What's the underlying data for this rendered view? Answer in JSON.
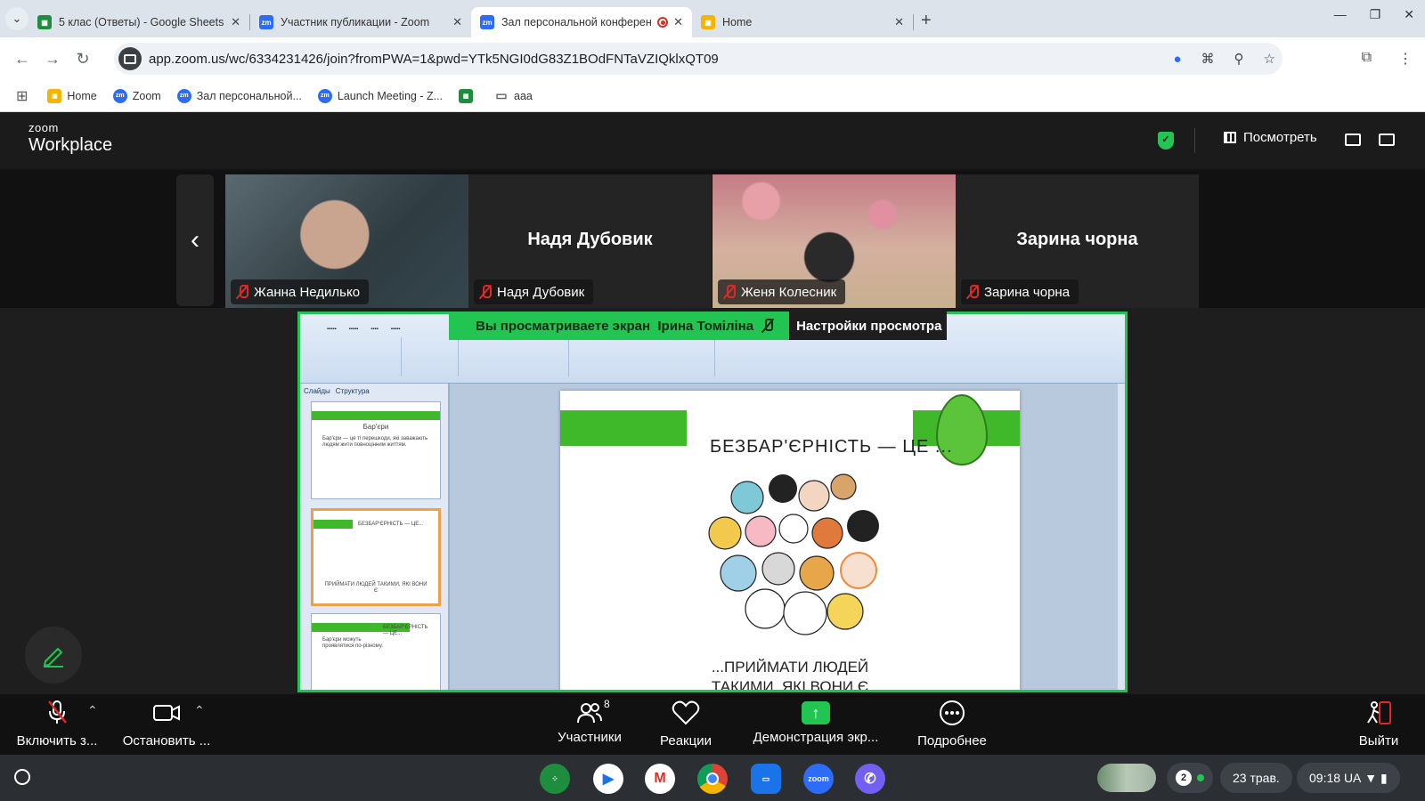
{
  "browser": {
    "tabs": [
      {
        "title": "5 клас (Ответы) - Google Sheets",
        "favicon": "sheets-icon",
        "color": "#1e8e3e",
        "active": false
      },
      {
        "title": "Участник публикации - Zoom",
        "favicon": "zoom-icon",
        "color": "#2d6cf6",
        "active": false
      },
      {
        "title": "Зал персональной конференции",
        "favicon": "zoom-icon",
        "color": "#2d6cf6",
        "active": true
      },
      {
        "title": "Home",
        "favicon": "classroom-icon",
        "color": "#f4b400",
        "active": false
      }
    ],
    "url": "app.zoom.us/wc/6334231426/join?fromPWA=1&pwd=YTk5NGI0dG83Z1BOdFNTaVZIQklxQT09",
    "bookmarks": [
      {
        "label": "Home",
        "icon": "classroom-icon",
        "color": "#f4b400"
      },
      {
        "label": "Zoom",
        "icon": "zoom-icon",
        "color": "#2d6cf6"
      },
      {
        "label": "Зал персональной...",
        "icon": "zoom-icon",
        "color": "#2d6cf6"
      },
      {
        "label": "Launch Meeting - Z...",
        "icon": "zoom-icon",
        "color": "#2d6cf6"
      },
      {
        "label": "",
        "icon": "sheets-icon",
        "color": "#1e8e3e"
      },
      {
        "label": "aaa",
        "icon": "folder-icon",
        "color": "#5f6368"
      }
    ]
  },
  "zoom": {
    "logo_small": "zoom",
    "logo_big": "Workplace",
    "view_label": "Посмотреть",
    "participants_strip": [
      {
        "name": "Жанна Недилько",
        "video": true,
        "muted": true
      },
      {
        "name": "Надя Дубовик",
        "video": false,
        "muted": true,
        "big_name": "Надя Дубовик"
      },
      {
        "name": "Женя Колесник",
        "video": true,
        "muted": true
      },
      {
        "name": "Зарина чорна",
        "video": false,
        "muted": true,
        "big_name": "Зарина чорна"
      }
    ],
    "share_banner": {
      "text": "Вы просматриваете экран",
      "presenter": "Ірина Томіліна",
      "settings": "Настройки просмотра"
    },
    "slide": {
      "heading": "БЕЗБАР'ЄРНІСТЬ — ЦЕ ...",
      "footer": "...ПРИЙМАТИ ЛЮДЕЙ ТАКИМИ, ЯКІ ВОНИ Є",
      "outline_tabs": [
        "Слайды",
        "Структура"
      ],
      "thumbs": [
        {
          "title": "Бар'єри",
          "text": "Бар'єри — це ті перешкоди, які заважають людям жити повноцінним життям."
        },
        {
          "title": "БЕЗБАР'ЄРНІСТЬ — ЦЕ...",
          "text": "ПРИЙМАТИ ЛЮДЕЙ ТАКИМИ, ЯКІ ВОНИ Є"
        },
        {
          "title": "БЕЗБАР'ЄРНІСТЬ — ЦЕ...",
          "text": "Бар'єри можуть проявлятися по-різному."
        }
      ]
    },
    "toolbar": {
      "mic": "Включить з...",
      "video": "Остановить ...",
      "participants": "Участники",
      "participants_count": "8",
      "reactions": "Реакции",
      "share": "Демонстрация экр...",
      "more": "Подробнее",
      "leave": "Выйти"
    }
  },
  "shelf": {
    "apps": [
      {
        "name": "files-app-icon",
        "color": "#1e8e3e"
      },
      {
        "name": "play-store-icon",
        "color": "#ffffff"
      },
      {
        "name": "gmail-icon",
        "color": "#ffffff"
      },
      {
        "name": "chrome-icon",
        "color": "#ffffff"
      },
      {
        "name": "files-icon",
        "color": "#1a73e8"
      },
      {
        "name": "zoom-icon",
        "color": "#2d6cf6"
      },
      {
        "name": "viber-icon",
        "color": "#7360f2"
      }
    ],
    "notifications": "2",
    "date": "23 трав.",
    "time": "09:18",
    "locale": "UA"
  }
}
